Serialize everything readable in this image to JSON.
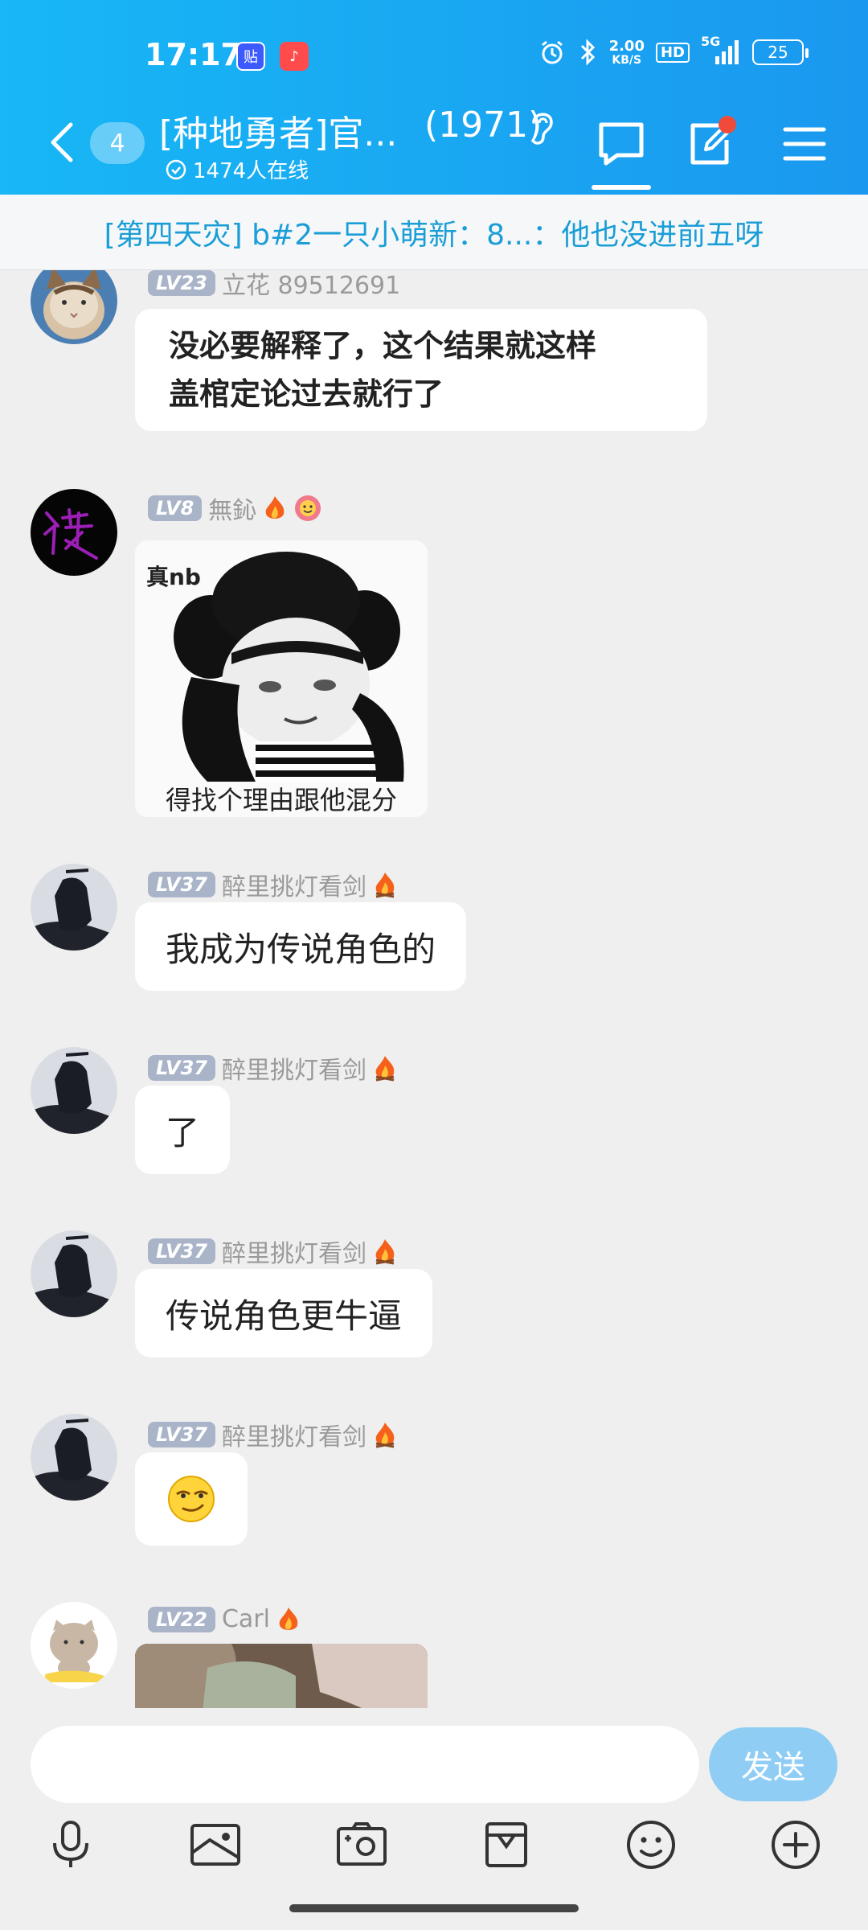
{
  "status_bar": {
    "time": "17:17",
    "app_badge_1": "贴",
    "app_badge_2": "♪",
    "net_speed_value": "2.00",
    "net_speed_unit": "KB/S",
    "hd": "HD",
    "network": "5G",
    "battery": "25"
  },
  "header": {
    "unread_count": "4",
    "title": "[种地勇者]官...",
    "member_count": "(1971)",
    "online": "1474人在线"
  },
  "notice": {
    "text": "[第四天灾] b#2一只小萌新：8...：他也没进前五呀"
  },
  "messages": [
    {
      "level": "LV23",
      "name": "立花 89512691",
      "text": "没必要解释了，这个结果就这样\n盖棺定论过去就行了"
    },
    {
      "level": "LV8",
      "name": "無鈊",
      "sticker_caption_top": "真nb",
      "sticker_caption_bottom": "得找个理由跟他混分"
    },
    {
      "level": "LV37",
      "name": "醉里挑灯看剑",
      "text": "我成为传说角色的"
    },
    {
      "level": "LV37",
      "name": "醉里挑灯看剑",
      "text": "了"
    },
    {
      "level": "LV37",
      "name": "醉里挑灯看剑",
      "text": "传说角色更牛逼"
    },
    {
      "level": "LV37",
      "name": "醉里挑灯看剑",
      "emoji": "smirk-face-emoji"
    },
    {
      "level": "LV22",
      "name": "Carl"
    }
  ],
  "input": {
    "placeholder": "",
    "send_label": "发送"
  },
  "toolbar_icons": [
    "microphone-icon",
    "image-icon",
    "camera-icon",
    "gift-icon",
    "emoji-icon",
    "plus-icon"
  ],
  "colors": {
    "header_start": "#18b7f5",
    "header_end": "#1a98ef",
    "notice_text": "#1a9ed6",
    "send_button": "#8fcdf5",
    "level_badge": "#aab4c9",
    "notification_dot": "#f04b3a"
  }
}
